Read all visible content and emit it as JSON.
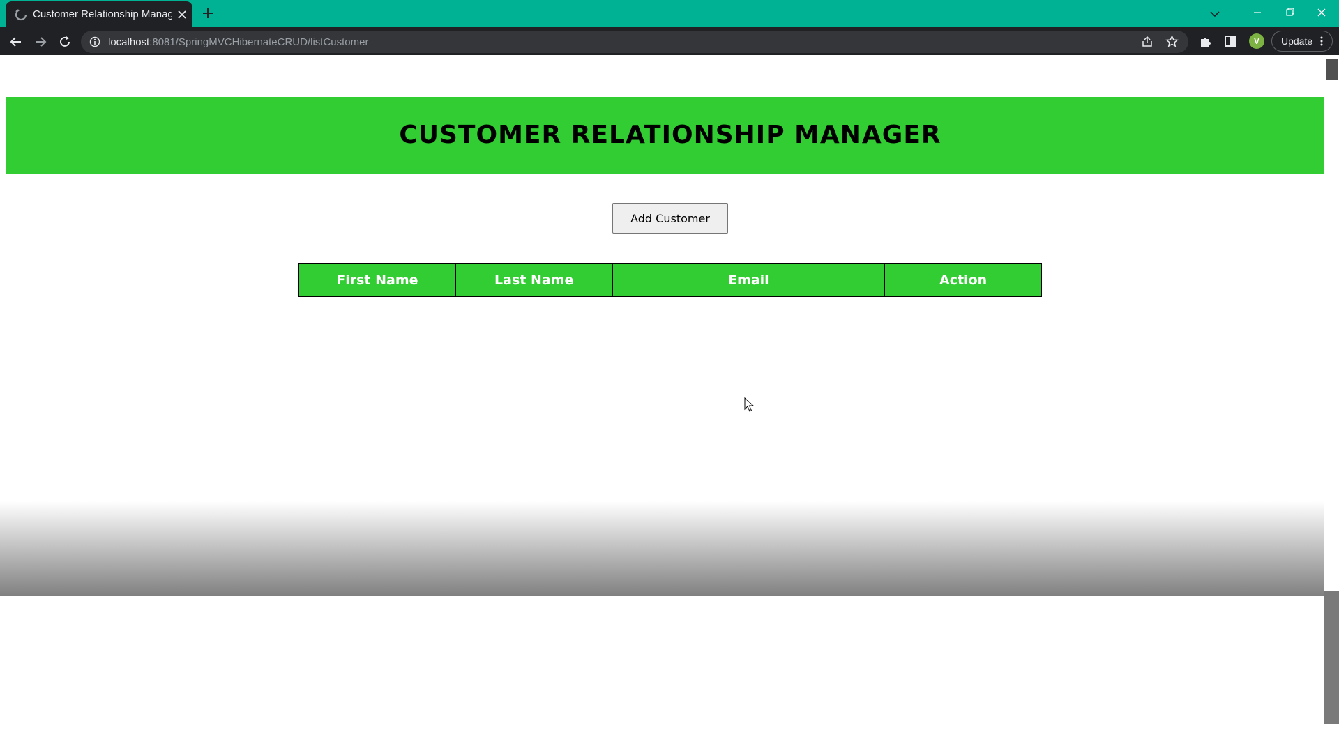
{
  "browser": {
    "tab_title": "Customer Relationship Managem",
    "url_host": "localhost",
    "url_rest": ":8081/SpringMVCHibernateCRUD/listCustomer",
    "profile_initial": "V",
    "update_label": "Update"
  },
  "page": {
    "title": "CUSTOMER RELATIONSHIP MANAGER",
    "add_button_label": "Add Customer",
    "table": {
      "columns": [
        "First Name",
        "Last Name",
        "Email",
        "Action"
      ],
      "rows": []
    }
  },
  "colors": {
    "accent_green": "#32cd32",
    "titlebar": "#00b294",
    "chrome_dark": "#202124"
  },
  "icons": {
    "favicon": "loading-spinner-icon",
    "tab_close": "close-icon",
    "new_tab": "plus-icon",
    "back": "arrow-left-icon",
    "forward": "arrow-right-icon",
    "reload": "reload-icon",
    "site_info": "info-icon",
    "share": "share-icon",
    "bookmark": "star-icon",
    "extensions": "puzzle-icon",
    "side_panel": "side-panel-icon",
    "menu": "vertical-dots-icon"
  }
}
